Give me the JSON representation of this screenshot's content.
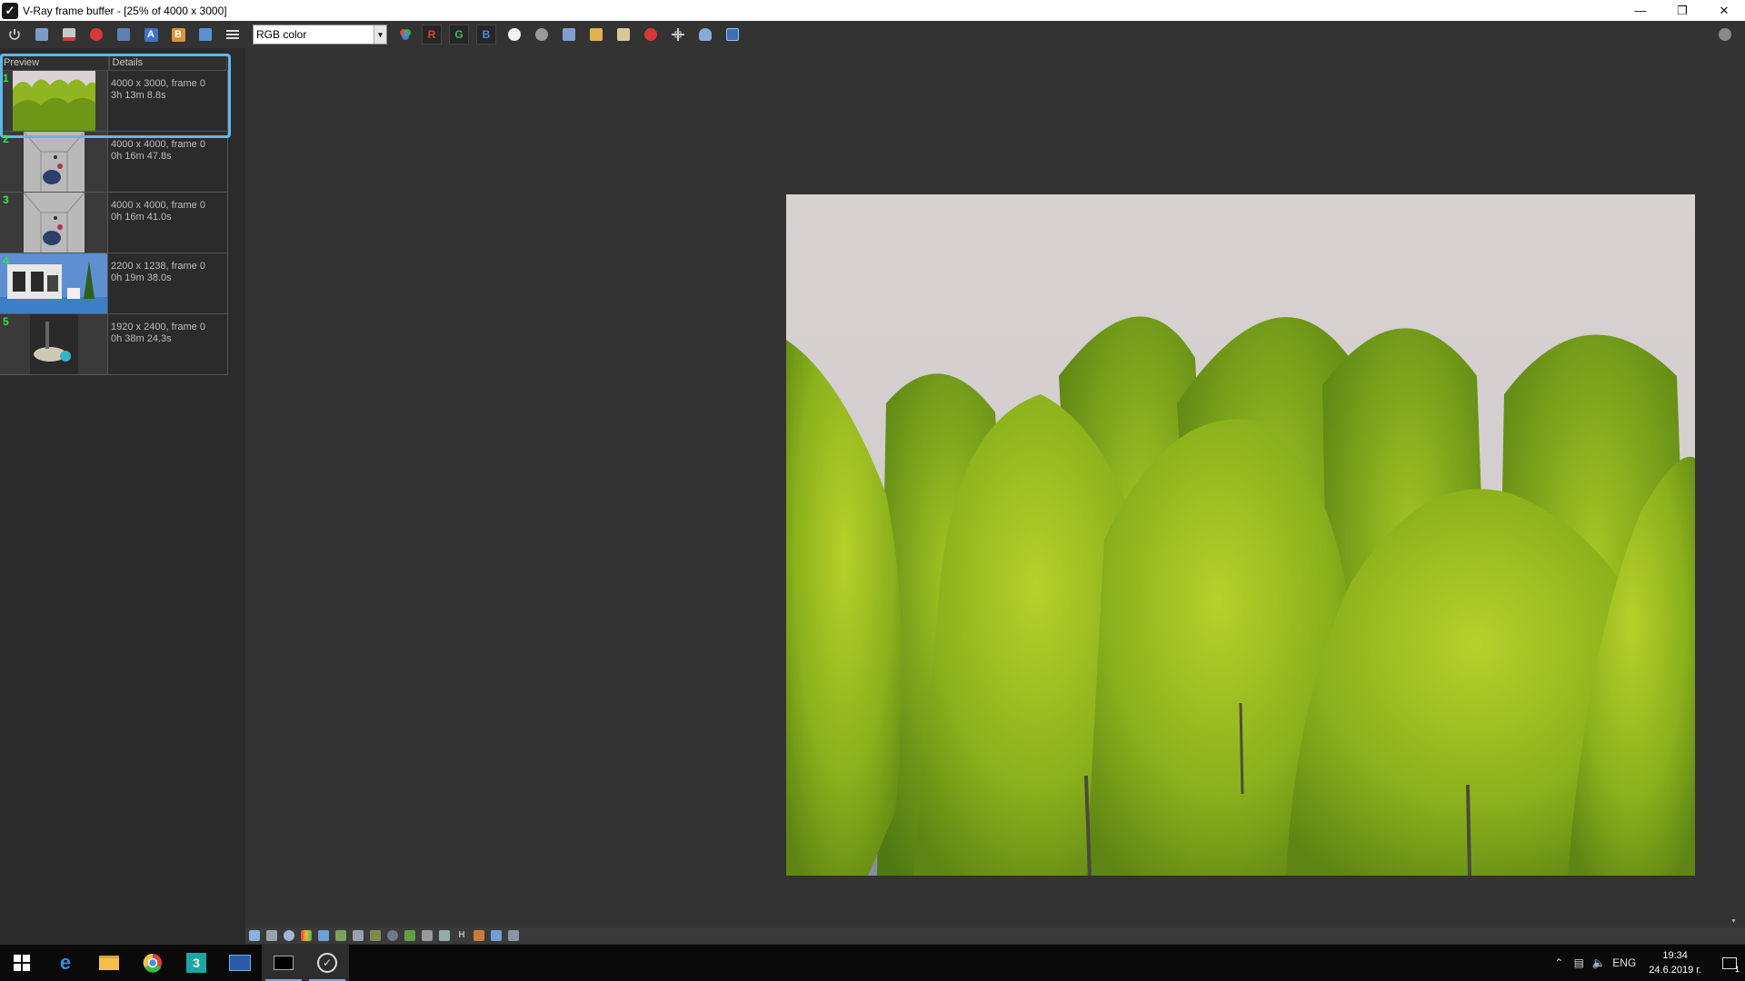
{
  "window": {
    "title": "V-Ray frame buffer - [25% of 4000 x 3000]",
    "app_icon": "vray-logo-icon"
  },
  "toolbar": {
    "channel_value": "RGB color",
    "r_label": "R",
    "g_label": "G",
    "b_label": "B",
    "icons": [
      "power-icon",
      "save-icon",
      "save-all-icon",
      "clear-icon",
      "history-icon",
      "text-a-icon",
      "text-b-icon",
      "compare-icon",
      "menu-icon"
    ],
    "right_icons": [
      "color-correct-icon",
      "track-mouse-icon",
      "lens-effects-icon",
      "load-icon",
      "open-folder-icon",
      "copy-icon",
      "stop-icon",
      "region-icon",
      "render-icon",
      "interactive-icon",
      "settings-icon"
    ]
  },
  "history": {
    "header_preview": "Preview",
    "header_details": "Details",
    "items": [
      {
        "num": "1",
        "size": "4000 x 3000, frame 0",
        "time": "3h 13m 8.8s"
      },
      {
        "num": "2",
        "size": "4000 x 4000, frame 0",
        "time": "0h 16m 47.8s"
      },
      {
        "num": "3",
        "size": "4000 x 4000, frame 0",
        "time": "0h 16m 41.0s"
      },
      {
        "num": "4",
        "size": "2200 x 1238, frame 0",
        "time": "0h 19m 38.0s"
      },
      {
        "num": "5",
        "size": "1920 x 2400, frame 0",
        "time": "0h 38m 24.3s"
      }
    ]
  },
  "statusbar": {
    "icons": [
      "layers-icon",
      "channels-icon",
      "info-icon",
      "color-icon",
      "lut-icon",
      "display-icon",
      "histogram-icon",
      "curves-icon",
      "exposure-icon",
      "white-balance-icon",
      "sharpen-icon",
      "lens-icon",
      "h-icon",
      "resize-icon",
      "compare-icon",
      "stamp-icon"
    ],
    "h_label": "H"
  },
  "taskbar": {
    "apps": [
      "windows-start-icon",
      "edge-icon",
      "file-explorer-icon",
      "chrome-icon",
      "3dsmax-icon",
      "vray-vfb-icon",
      "terminal-icon",
      "vray-icon"
    ],
    "lang": "ENG",
    "time": "19:34",
    "date": "24.6.2019 г.",
    "notification_count": "1"
  },
  "colors": {
    "accent_selection": "#5fb8ec",
    "history_number": "#36e24b",
    "red": "#e0433b",
    "green": "#3cbc4a",
    "blue": "#4a8de0"
  }
}
